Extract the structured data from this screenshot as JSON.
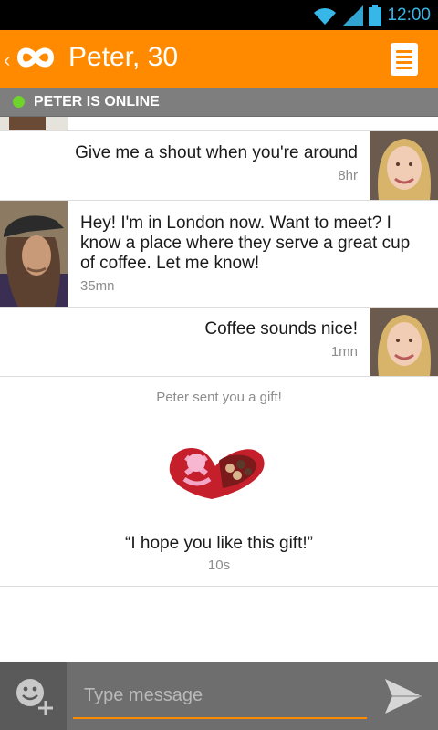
{
  "status_bar": {
    "time": "12:00",
    "icons": [
      "wifi-icon",
      "signal-icon",
      "battery-icon"
    ],
    "time_color": "#37b6e8"
  },
  "app_bar": {
    "title": "Peter, 30",
    "logo": "infinity-logo-icon",
    "menu_icon": "list-menu-icon",
    "back_icon": "chevron-left-icon",
    "color": "#ff8a00"
  },
  "presence": {
    "text": "PETER IS ONLINE",
    "dot_color": "#6ed32a"
  },
  "messages": [
    {
      "from": "me",
      "text": "Give me a shout when you're around",
      "time": "8hr",
      "avatar": "woman-avatar"
    },
    {
      "from": "peter",
      "text": "Hey! I'm in London now. Want to meet? I know a place where they serve a great cup of coffee. Let me know!",
      "time": "35mn",
      "avatar": "man-avatar"
    },
    {
      "from": "me",
      "text": "Coffee sounds nice!",
      "time": "1mn",
      "avatar": "woman-avatar"
    }
  ],
  "gift": {
    "note": "Peter sent you a gift!",
    "image": "heart-chocolate-box-icon",
    "message": "“I hope you like this gift!”",
    "time": "10s"
  },
  "composer": {
    "placeholder": "Type message",
    "emoji_icon": "add-emoji-icon",
    "send_icon": "send-icon",
    "accent": "#ff8a00"
  }
}
